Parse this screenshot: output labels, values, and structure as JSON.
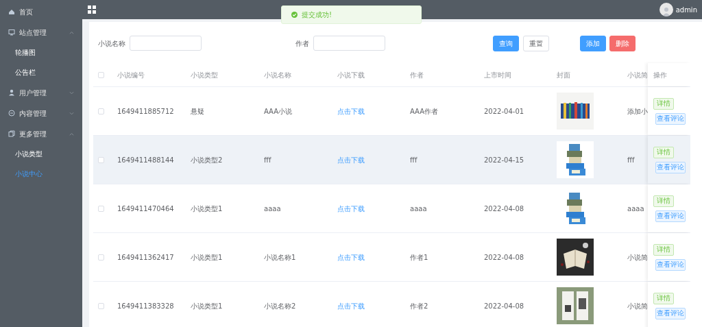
{
  "sidebar": {
    "items": [
      {
        "label": "首页"
      },
      {
        "label": "站点管理",
        "expanded": true,
        "children": [
          {
            "label": "轮播图",
            "selected": false
          },
          {
            "label": "公告栏",
            "selected": false
          }
        ]
      },
      {
        "label": "用户管理",
        "expanded": false
      },
      {
        "label": "内容管理",
        "expanded": false
      },
      {
        "label": "更多管理",
        "expanded": true,
        "children": [
          {
            "label": "小说类型",
            "selected": false
          },
          {
            "label": "小说中心",
            "selected": true
          }
        ]
      }
    ]
  },
  "header": {
    "user": "admin"
  },
  "toast": {
    "message": "提交成功!"
  },
  "filters": [
    {
      "label": "小说名称"
    },
    {
      "label": "作者"
    }
  ],
  "buttons": [
    {
      "label": "查询",
      "kind": "primary"
    },
    {
      "label": "重置",
      "kind": "default"
    },
    {
      "label": "添加",
      "kind": "primary"
    },
    {
      "label": "删除",
      "kind": "danger"
    }
  ],
  "table": {
    "all_checked": false,
    "columns": [
      "小说编号",
      "小说类型",
      "小说名称",
      "小说下载",
      "作者",
      "上市时间",
      "封面",
      "小说简"
    ],
    "action_column": "操作",
    "rows": [
      {
        "checked": false,
        "highlighted": false,
        "cells": [
          "1649411885712",
          "悬疑",
          "AAA小说",
          "点击下载",
          "AAA作者",
          "2022-04-01",
          "",
          "添加小"
        ],
        "actions": [
          "详情",
          "查看评论"
        ]
      },
      {
        "checked": false,
        "highlighted": true,
        "cells": [
          "1649411488144",
          "小说类型2",
          "fff",
          "点击下载",
          "fff",
          "2022-04-15",
          "",
          "fff"
        ],
        "actions": [
          "详情",
          "查看评论"
        ]
      },
      {
        "checked": false,
        "highlighted": false,
        "cells": [
          "1649411470464",
          "小说类型1",
          "aaaa",
          "点击下载",
          "aaaa",
          "2022-04-08",
          "",
          "aaaa"
        ],
        "actions": [
          "详情",
          "查看评论"
        ]
      },
      {
        "checked": false,
        "highlighted": false,
        "cells": [
          "1649411362417",
          "小说类型1",
          "小说名称1",
          "点击下载",
          "作者1",
          "2022-04-08",
          "",
          "小说简"
        ],
        "actions": [
          "详情",
          "查看评论"
        ]
      },
      {
        "checked": false,
        "highlighted": false,
        "cells": [
          "1649411383328",
          "小说类型1",
          "小说名称2",
          "点击下载",
          "作者2",
          "2022-04-08",
          "",
          "小说简"
        ],
        "actions": [
          "详情",
          "查看评论"
        ]
      }
    ]
  }
}
